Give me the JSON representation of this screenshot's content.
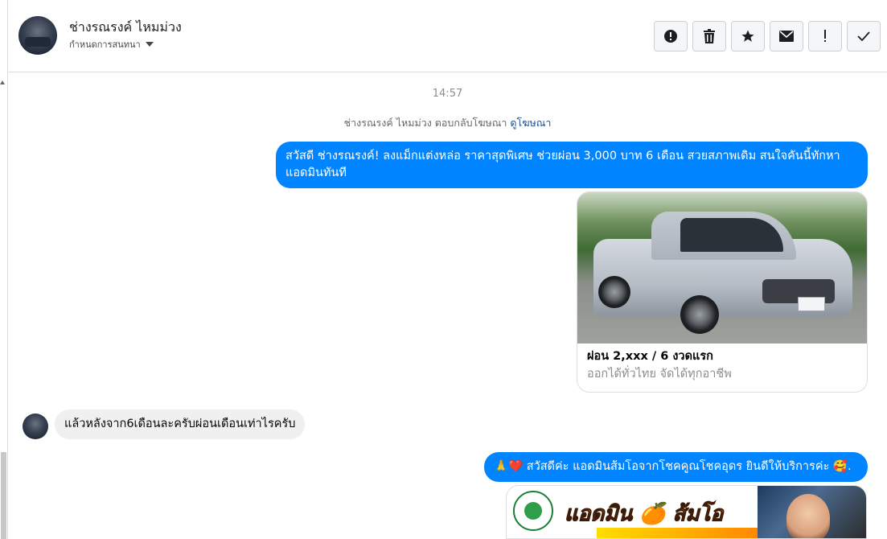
{
  "header": {
    "contact_name": "ช่างรณรงค์ ไหมม่วง",
    "assign_label": "กำหนดการสนทนา",
    "toolbar": [
      {
        "name": "alert-button",
        "icon": "alert-circle-icon",
        "glyph": "!"
      },
      {
        "name": "delete-button",
        "icon": "trash-icon",
        "glyph": "🗑"
      },
      {
        "name": "star-button",
        "icon": "star-icon",
        "glyph": "★"
      },
      {
        "name": "mark-unread-button",
        "icon": "envelope-icon",
        "glyph": "✉"
      },
      {
        "name": "spam-button",
        "icon": "exclamation-icon",
        "glyph": "!"
      },
      {
        "name": "done-button",
        "icon": "check-icon",
        "glyph": "✓"
      }
    ]
  },
  "thread": {
    "timestamp": "14:57",
    "ad_context_text": "ช่างรณรงค์ ไหมม่วง ตอบกลับโฆษณา",
    "ad_context_link": "ดูโฆษณา",
    "messages": [
      {
        "direction": "out",
        "text": "สวัสดี ช่างรณรงค์! ลงแม็กแต่งหล่อ ราคาสุดพิเศษ ช่วยผ่อน 3,000 บาท 6 เดือน สวยสภาพเดิม สนใจคันนี้ทักหาแอดมินทันที"
      },
      {
        "direction": "in",
        "text": "แล้วหลังจาก6เดือนละครับผ่อนเดือนเท่าไรครับ"
      },
      {
        "direction": "out",
        "text": "🙏❤️ สวัสดีค่ะ แอดมินส้มโอจากโชคคูณโชคอุดร ยินดีให้บริการค่ะ 🥰."
      }
    ],
    "ad_card": {
      "title": "ผ่อน 2,xxx / 6 งวดแรก",
      "subtitle": "ออกได้ทั่วไทย จัดได้ทุกอาชีพ"
    },
    "promo_banner": {
      "title": "แอดมิน 🍊 ส้มโอ"
    }
  },
  "colors": {
    "outgoing_bubble": "#0084ff",
    "incoming_bubble": "#f0f0f0",
    "link": "#1d4e89"
  }
}
